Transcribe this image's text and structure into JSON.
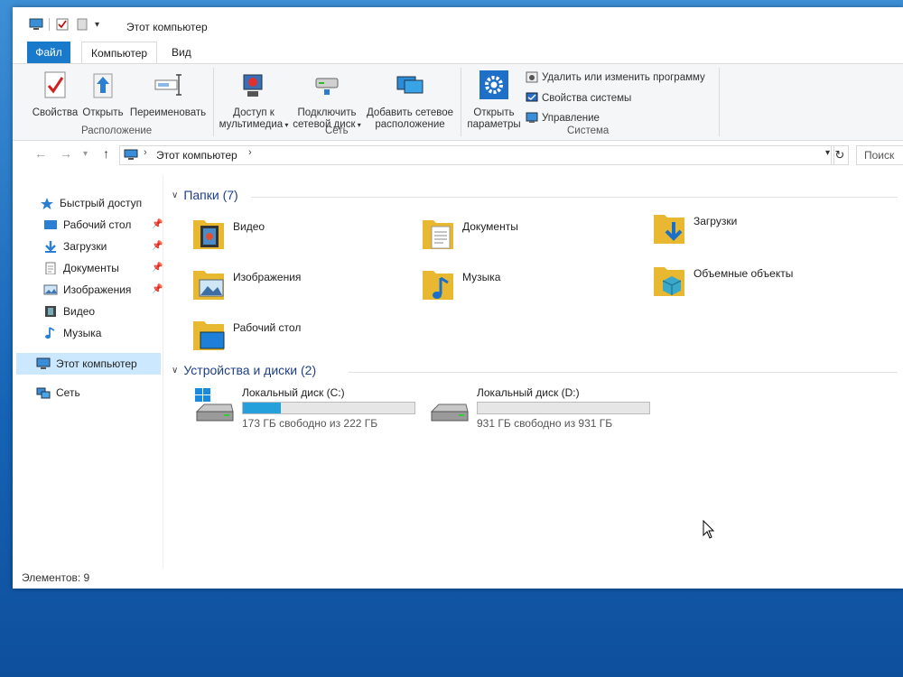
{
  "window": {
    "title": "Этот компьютер"
  },
  "tabs": {
    "file": "Файл",
    "computer": "Компьютер",
    "view": "Вид"
  },
  "ribbon": {
    "location_group": {
      "label": "Расположение",
      "properties": "Свойства",
      "open": "Открыть",
      "rename": "Переименовать"
    },
    "network_group": {
      "label": "Сеть",
      "media_access_l1": "Доступ к",
      "media_access_l2": "мультимедиа",
      "map_drive_l1": "Подключить",
      "map_drive_l2": "сетевой диск",
      "add_location_l1": "Добавить сетевое",
      "add_location_l2": "расположение"
    },
    "system_group": {
      "label": "Система",
      "open_settings_l1": "Открыть",
      "open_settings_l2": "параметры",
      "uninstall": "Удалить или изменить программу",
      "system_properties": "Свойства системы",
      "manage": "Управление"
    }
  },
  "address": {
    "path": "Этот компьютер",
    "search_placeholder": "Поиск"
  },
  "navpane": {
    "quick_access": "Быстрый доступ",
    "items": [
      "Рабочий стол",
      "Загрузки",
      "Документы",
      "Изображения",
      "Видео",
      "Музыка"
    ],
    "this_pc": "Этот компьютер",
    "network": "Сеть"
  },
  "folders_section": {
    "title": "Папки (7)",
    "items": [
      "Видео",
      "Документы",
      "Загрузки",
      "Изображения",
      "Музыка",
      "Объемные объекты",
      "Рабочий стол"
    ]
  },
  "drives_section": {
    "title": "Устройства и диски (2)",
    "drives": [
      {
        "name": "Локальный диск (C:)",
        "free": "173 ГБ свободно из 222 ГБ",
        "used_fraction": 0.22
      },
      {
        "name": "Локальный диск (D:)",
        "free": "931 ГБ свободно из 931 ГБ",
        "used_fraction": 0.0
      }
    ]
  },
  "status": {
    "items_count": "Элементов: 9"
  }
}
